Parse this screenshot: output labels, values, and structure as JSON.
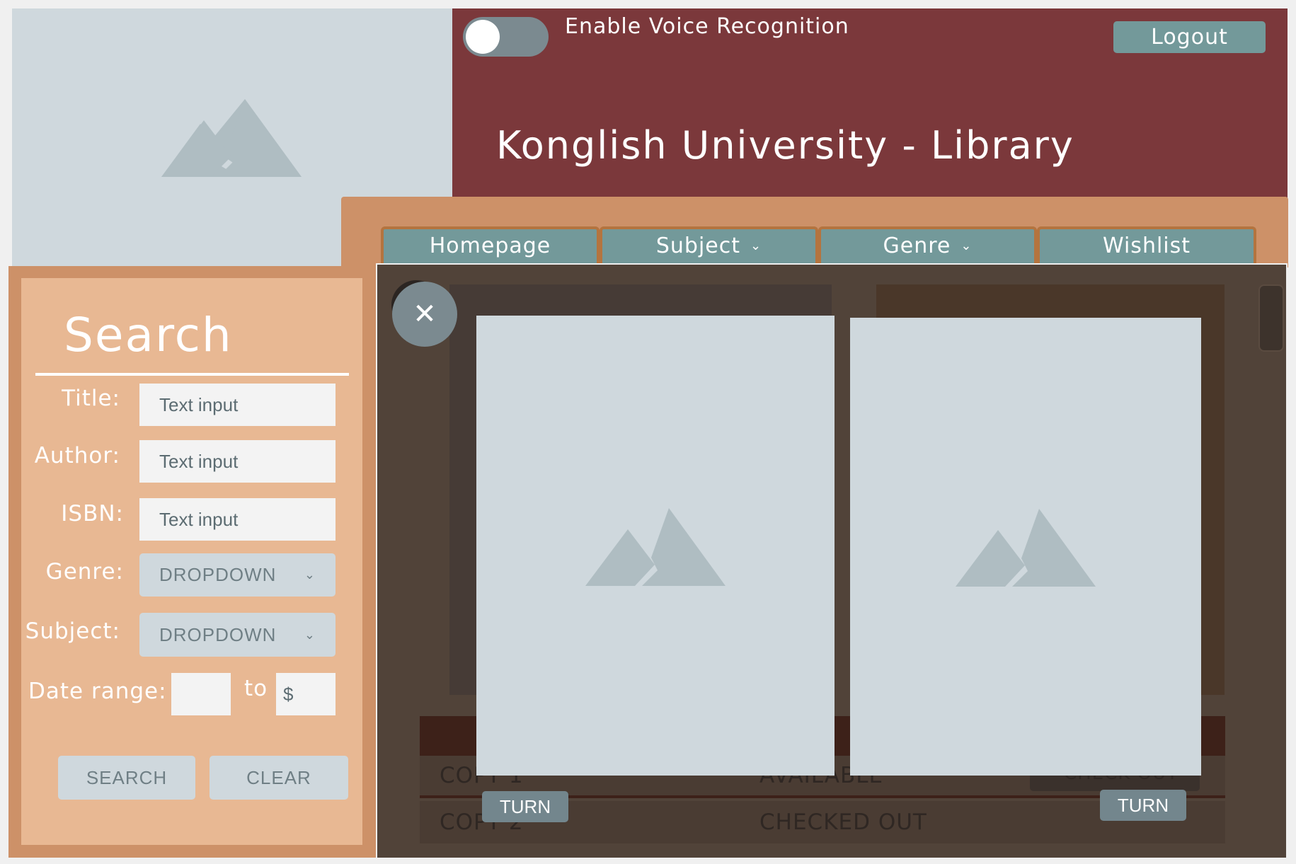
{
  "header": {
    "voice_toggle_label": "Enable Voice Recognition",
    "logout_label": "Logout",
    "site_title": "Konglish University - Library"
  },
  "nav": {
    "tabs": [
      {
        "label": "Homepage"
      },
      {
        "label": "Subject"
      },
      {
        "label": "Genre"
      },
      {
        "label": "Wishlist"
      }
    ]
  },
  "search": {
    "title": "Search",
    "title_label": "Title:",
    "title_placeholder": "Text input",
    "author_label": "Author:",
    "author_placeholder": "Text input",
    "isbn_label": "ISBN:",
    "isbn_placeholder": "Text input",
    "genre_label": "Genre:",
    "genre_value": "DROPDOWN",
    "subject_label": "Subject:",
    "subject_value": "DROPDOWN",
    "date_label": "Date range:",
    "date_to": "to",
    "date_to_prefix": "$",
    "search_button": "SEARCH",
    "clear_button": "CLEAR"
  },
  "background_table": {
    "rows": [
      {
        "copy": "COPY 1",
        "status": "AVAILABLE",
        "action": "CHECK OUT"
      },
      {
        "copy": "COPY 2",
        "status": "CHECKED OUT"
      }
    ]
  },
  "modal": {
    "close_icon": "close-icon",
    "left_turn": "TURN",
    "right_turn": "TURN"
  }
}
